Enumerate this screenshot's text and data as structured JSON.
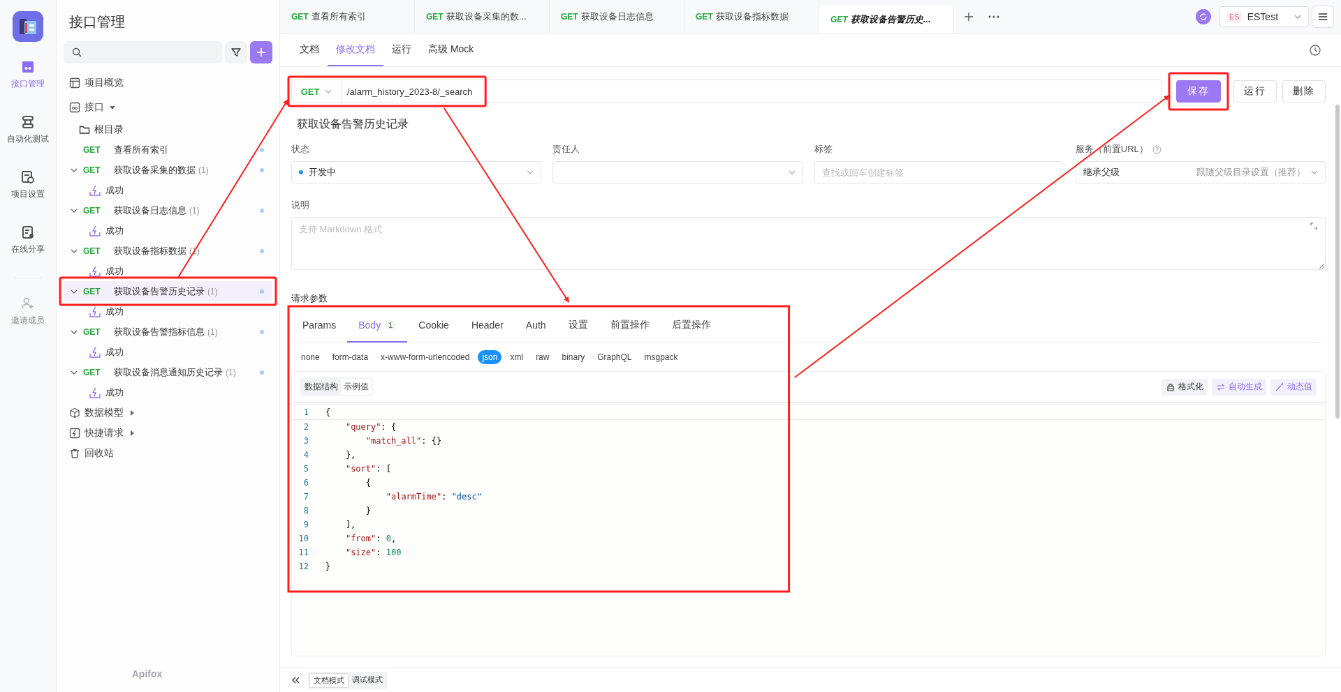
{
  "rail": {
    "items": [
      {
        "kind": "api",
        "label": "接口管理",
        "selected": true
      },
      {
        "kind": "test",
        "label": "自动化测试",
        "selected": false
      },
      {
        "kind": "settings",
        "label": "项目设置",
        "selected": false
      },
      {
        "kind": "share",
        "label": "在线分享",
        "selected": false
      },
      {
        "kind": "invite",
        "label": "邀请成员",
        "selected": false
      }
    ]
  },
  "nav": {
    "title": "接口管理",
    "brand": "Apifox",
    "items": [
      {
        "kind": "overview",
        "label": "项目概览"
      },
      {
        "kind": "section",
        "label": "接口",
        "expanded": true,
        "children": [
          {
            "kind": "folder",
            "label": "根目录",
            "children": [
              {
                "kind": "endpoint",
                "method": "GET",
                "label": "查看所有索引",
                "selected": false,
                "annotated": false
              },
              {
                "kind": "endpoint",
                "method": "GET",
                "label": "获取设备采集的数据",
                "count": "(1)",
                "expanded": true,
                "selected": false,
                "annotated": false,
                "children": [
                  {
                    "kind": "example",
                    "label": "成功"
                  }
                ]
              },
              {
                "kind": "endpoint",
                "method": "GET",
                "label": "获取设备日志信息",
                "count": "(1)",
                "expanded": true,
                "selected": false,
                "annotated": false,
                "children": [
                  {
                    "kind": "example",
                    "label": "成功"
                  }
                ]
              },
              {
                "kind": "endpoint",
                "method": "GET",
                "label": "获取设备指标数据",
                "count": "(1)",
                "expanded": true,
                "selected": false,
                "annotated": false,
                "children": [
                  {
                    "kind": "example",
                    "label": "成功"
                  }
                ]
              },
              {
                "kind": "endpoint",
                "method": "GET",
                "label": "获取设备告警历史记录",
                "count": "(1)",
                "expanded": true,
                "selected": true,
                "annotated": true,
                "children": [
                  {
                    "kind": "example",
                    "label": "成功"
                  }
                ]
              },
              {
                "kind": "endpoint",
                "method": "GET",
                "label": "获取设备告警指标信息",
                "count": "(1)",
                "expanded": true,
                "selected": false,
                "annotated": false,
                "children": [
                  {
                    "kind": "example",
                    "label": "成功"
                  }
                ]
              },
              {
                "kind": "endpoint",
                "method": "GET",
                "label": "获取设备消息通知历史记录",
                "count": "(1)",
                "expanded": true,
                "selected": false,
                "annotated": false,
                "children": [
                  {
                    "kind": "example",
                    "label": "成功"
                  }
                ]
              }
            ]
          }
        ]
      },
      {
        "kind": "model",
        "label": "数据模型",
        "expanded": false
      },
      {
        "kind": "quick",
        "label": "快捷请求",
        "expanded": false
      },
      {
        "kind": "trash",
        "label": "回收站"
      }
    ]
  },
  "tabs": [
    {
      "method": "GET",
      "label": "查看所有索引",
      "selected": false
    },
    {
      "method": "GET",
      "label": "获取设备采集的数...",
      "selected": false
    },
    {
      "method": "GET",
      "label": "获取设备日志信息",
      "selected": false
    },
    {
      "method": "GET",
      "label": "获取设备指标数据",
      "selected": false
    },
    {
      "method": "GET",
      "label": "获取设备告警历史...",
      "selected": true
    }
  ],
  "environment": {
    "badge": "ES",
    "name": "ESTest"
  },
  "subtabs": [
    {
      "label": "文档",
      "selected": false
    },
    {
      "label": "修改文档",
      "selected": true
    },
    {
      "label": "运行",
      "selected": false
    },
    {
      "label": "高级 Mock",
      "selected": false
    }
  ],
  "request": {
    "method": "GET",
    "url": "/alarm_history_2023-8/_search",
    "annotated": true
  },
  "actions": [
    {
      "kind": "primary",
      "label": "保存",
      "annotated": true
    },
    {
      "kind": "plain",
      "label": "运行",
      "annotated": false
    },
    {
      "kind": "plain",
      "label": "删除",
      "annotated": false
    }
  ],
  "name": "获取设备告警历史记录",
  "fields": [
    {
      "kind": "status",
      "label": "状态",
      "value": "开发中",
      "color": "#1e90ff"
    },
    {
      "kind": "select",
      "label": "责任人"
    },
    {
      "kind": "tags",
      "label": "标签",
      "placeholder": "查找或回车创建标签"
    },
    {
      "kind": "service",
      "label": "服务（前置URL）",
      "value": "继承父级",
      "hint": "跟随父级目录设置（推荐）"
    }
  ],
  "description": {
    "label": "说明",
    "placeholder": "支持 Markdown 格式"
  },
  "params": {
    "title": "请求参数",
    "annotated": true,
    "tabs": [
      {
        "label": "Params",
        "selected": false
      },
      {
        "label": "Body",
        "badge": "1",
        "selected": true
      },
      {
        "label": "Cookie",
        "selected": false
      },
      {
        "label": "Header",
        "selected": false
      },
      {
        "label": "Auth",
        "selected": false
      },
      {
        "label": "设置",
        "selected": false
      },
      {
        "label": "前置操作",
        "selected": false
      },
      {
        "label": "后置操作",
        "selected": false
      }
    ],
    "body_types": [
      {
        "label": "none",
        "selected": false
      },
      {
        "label": "form-data",
        "selected": false
      },
      {
        "label": "x-www-form-urlencoded",
        "selected": false
      },
      {
        "label": "json",
        "selected": true
      },
      {
        "label": "xml",
        "selected": false
      },
      {
        "label": "raw",
        "selected": false
      },
      {
        "label": "binary",
        "selected": false
      },
      {
        "label": "GraphQL",
        "selected": false
      },
      {
        "label": "msgpack",
        "selected": false
      }
    ],
    "views": [
      {
        "label": "数据结构",
        "selected": false
      },
      {
        "label": "示例值",
        "selected": true
      }
    ],
    "tools": [
      {
        "kind": "format",
        "label": "格式化"
      },
      {
        "kind": "auto",
        "label": "自动生成"
      },
      {
        "kind": "dynamic",
        "label": "动态值"
      }
    ],
    "code": [
      {
        "number": "1",
        "text": "{"
      },
      {
        "number": "2",
        "text": "    \"query\": {"
      },
      {
        "number": "3",
        "text": "        \"match_all\": {}"
      },
      {
        "number": "4",
        "text": "    },"
      },
      {
        "number": "5",
        "text": "    \"sort\": ["
      },
      {
        "number": "6",
        "text": "        {"
      },
      {
        "number": "7",
        "text": "            \"alarmTime\": \"desc\""
      },
      {
        "number": "8",
        "text": "        }"
      },
      {
        "number": "9",
        "text": "    ],"
      },
      {
        "number": "10",
        "text": "    \"from\": 0,"
      },
      {
        "number": "11",
        "text": "    \"size\": 100"
      },
      {
        "number": "12",
        "text": "}"
      }
    ]
  },
  "modes": [
    {
      "label": "文档模式",
      "selected": true
    },
    {
      "label": "调试模式",
      "selected": false
    }
  ]
}
